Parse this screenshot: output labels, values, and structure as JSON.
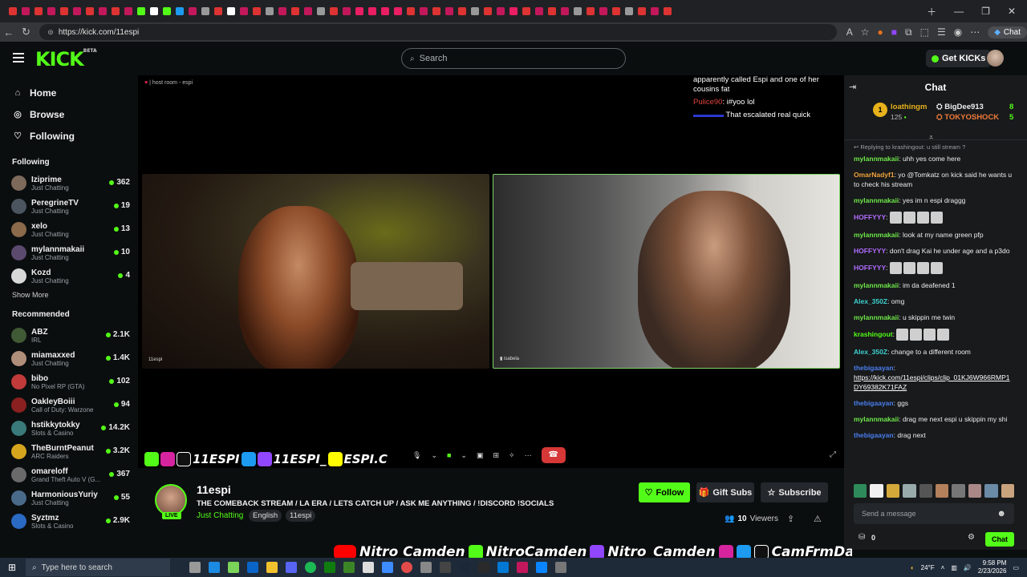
{
  "browser": {
    "url": "https://kick.com/11espi",
    "chat_button": "Chat"
  },
  "header": {
    "logo": "KICK",
    "logo_badge": "BETA",
    "search_placeholder": "Search",
    "get_kicks": "Get KICKs"
  },
  "sidebar": {
    "nav": [
      {
        "label": "Home",
        "icon": "home-icon"
      },
      {
        "label": "Browse",
        "icon": "compass-icon"
      },
      {
        "label": "Following",
        "icon": "heart-icon"
      }
    ],
    "following_title": "Following",
    "following": [
      {
        "name": "Iziprime",
        "category": "Just Chatting",
        "viewers": "362",
        "color": "#7d6a5b"
      },
      {
        "name": "PeregrineTV",
        "category": "Just Chatting",
        "viewers": "19",
        "color": "#4a5560"
      },
      {
        "name": "xelo",
        "category": "Just Chatting",
        "viewers": "13",
        "color": "#8a6a4a"
      },
      {
        "name": "mylannmakaii",
        "category": "Just Chatting",
        "viewers": "10",
        "color": "#5b4a6e"
      },
      {
        "name": "Kozd",
        "category": "Just Chatting",
        "viewers": "4",
        "color": "#d8d8d8"
      }
    ],
    "show_more": "Show More",
    "recommended_title": "Recommended",
    "recommended": [
      {
        "name": "ABZ",
        "category": "IRL",
        "viewers": "2.1K",
        "color": "#3f5a35"
      },
      {
        "name": "miamaxxed",
        "category": "Just Chatting",
        "viewers": "1.4K",
        "color": "#b08f7a"
      },
      {
        "name": "bibo",
        "category": "No Pixel RP (GTA)",
        "viewers": "102",
        "color": "#c23a3a"
      },
      {
        "name": "OakleyBoiii",
        "category": "Call of Duty: Warzone",
        "viewers": "94",
        "color": "#8a2020"
      },
      {
        "name": "hstikkytokky",
        "category": "Slots & Casino",
        "viewers": "14.2K",
        "color": "#3a7a7a"
      },
      {
        "name": "TheBurntPeanut",
        "category": "ARC Raiders",
        "viewers": "3.2K",
        "color": "#d6a51e"
      },
      {
        "name": "omareloff",
        "category": "Grand Theft Auto V (G...",
        "viewers": "367",
        "color": "#6a6a6a"
      },
      {
        "name": "HarmoniousYuriy",
        "category": "Just Chatting",
        "viewers": "55",
        "color": "#4a6a8a"
      },
      {
        "name": "Syztmz",
        "category": "Slots & Casino",
        "viewers": "2.9K",
        "color": "#2a6ac2"
      }
    ]
  },
  "player": {
    "host_label": "| host room - espi",
    "cam1_name": "11espi",
    "cam2_name": "isabela",
    "overlay_chat": [
      {
        "user": "",
        "text": "apparently called Espi and one of her cousins fat"
      },
      {
        "user": "Pulice90",
        "text": "i#yoo lol"
      },
      {
        "user": "",
        "text": "That escalated real quick"
      }
    ],
    "socials_text_1": "11ESPI",
    "socials_text_2": "11ESPI_",
    "socials_text_3": "ESPI.C"
  },
  "stream": {
    "streamer": "11espi",
    "live": "LIVE",
    "title": "THE COMEBACK STREAM / LA ERA / LETS CATCH UP / ASK ME ANYTHING / !DISCORD !SOCIALS",
    "category": "Just Chatting",
    "tags": [
      "English",
      "11espi"
    ],
    "follow": "Follow",
    "gift_subs": "Gift Subs",
    "subscribe": "Subscribe",
    "viewers_count": "10",
    "viewers_label": "Viewers"
  },
  "chat": {
    "title": "Chat",
    "leaderboard": [
      {
        "rank": "1",
        "name": "loathingm",
        "points": "125"
      },
      {
        "name": "BigDee913",
        "value": "8"
      },
      {
        "name": "TOKYOSHOCK",
        "value": "5"
      }
    ],
    "reply_note": "Replying to krashingout: u still stream ?",
    "messages": [
      {
        "user": "mylannmakaii",
        "color": "#6ee84a",
        "text": "uhh yes come here"
      },
      {
        "user": "OmarNadyf1",
        "color": "#f0a23a",
        "text": "yo @Tomkatz on kick said he wants u to check his stream"
      },
      {
        "user": "mylannmakaii",
        "color": "#6ee84a",
        "text": "yes im n espi draggg"
      },
      {
        "user": "HOFFYYY",
        "color": "#b26cff",
        "text": ""
      },
      {
        "user": "mylannmakaii",
        "color": "#6ee84a",
        "text": "look at my name green pfp"
      },
      {
        "user": "HOFFYYY",
        "color": "#b26cff",
        "text": "don't drag Kai he under age and a p3do"
      },
      {
        "user": "HOFFYYY",
        "color": "#b26cff",
        "text": ""
      },
      {
        "user": "mylannmakaii",
        "color": "#6ee84a",
        "text": "im da deafened 1"
      },
      {
        "user": "Alex_350Z",
        "color": "#3ed1d1",
        "text": "omg"
      },
      {
        "user": "mylannmakaii",
        "color": "#6ee84a",
        "text": "u skippin me twin"
      },
      {
        "user": "krashingout",
        "color": "#53fc18",
        "text": ""
      },
      {
        "user": "Alex_350Z",
        "color": "#3ed1d1",
        "text": "change to a different room"
      },
      {
        "user": "thebigaayan",
        "color": "#4a7ef0",
        "text": "https://kick.com/11espi/clips/clip_01KJ6W966RMP1DY69382K71FAZ"
      },
      {
        "user": "thebigaayan",
        "color": "#4a7ef0",
        "text": "ggs"
      },
      {
        "user": "mylannmakaii",
        "color": "#6ee84a",
        "text": "drag me next espi u skippin my shi"
      },
      {
        "user": "thebigaayan",
        "color": "#4a7ef0",
        "text": "drag next"
      }
    ],
    "input_placeholder": "Send a message",
    "points": "0",
    "send_button": "Chat"
  },
  "banner": {
    "parts": [
      "Nitro Camden",
      "NitroCamden",
      "Nitro_Camden",
      "CamFrmDaLou"
    ]
  },
  "taskbar": {
    "search_placeholder": "Type here to search",
    "weather": "24°F",
    "time": "9:58 PM",
    "date": "2/23/2026"
  }
}
